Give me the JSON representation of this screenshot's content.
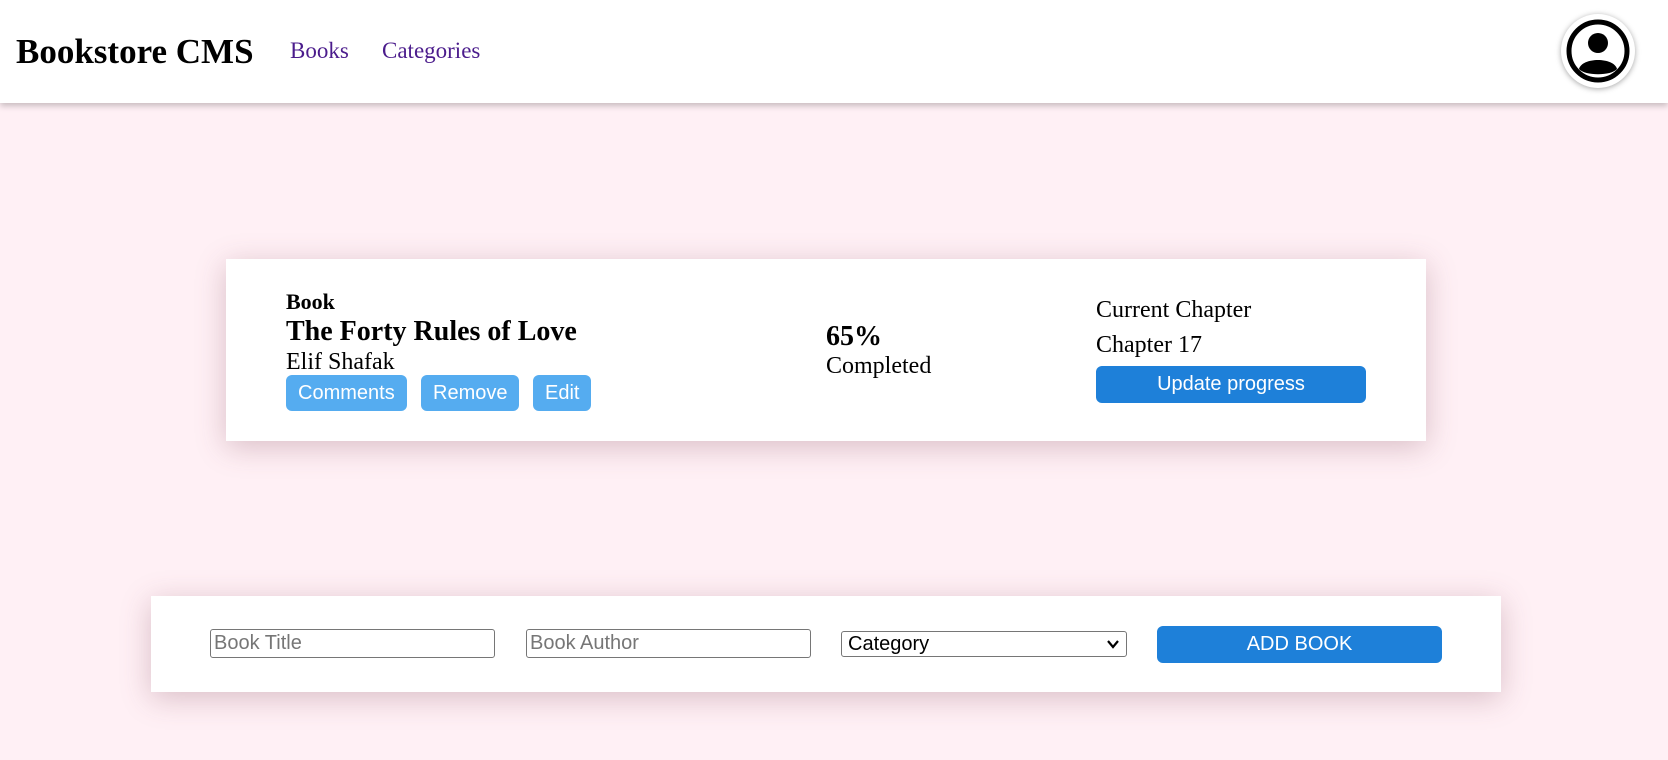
{
  "header": {
    "brand": "Bookstore CMS",
    "nav": {
      "books": "Books",
      "categories": "Categories"
    },
    "avatar_icon": "user-circle-icon"
  },
  "book": {
    "genre": "Book",
    "title": "The Forty Rules of Love",
    "author": "Elif Shafak",
    "actions": {
      "comments": "Comments",
      "remove": "Remove",
      "edit": "Edit"
    },
    "progress_percent": "65%",
    "progress_label": "Completed",
    "chapter_label": "Current Chapter",
    "chapter_value": "Chapter 17",
    "update_label": "Update progress"
  },
  "form": {
    "title_placeholder": "Book Title",
    "author_placeholder": "Book Author",
    "category_selected": "Category",
    "add_label": "ADD BOOK"
  },
  "colors": {
    "background": "#fff0f5",
    "primary_button": "#1e80d9",
    "secondary_button": "#55acf0",
    "nav_link": "#4b1c8c"
  }
}
